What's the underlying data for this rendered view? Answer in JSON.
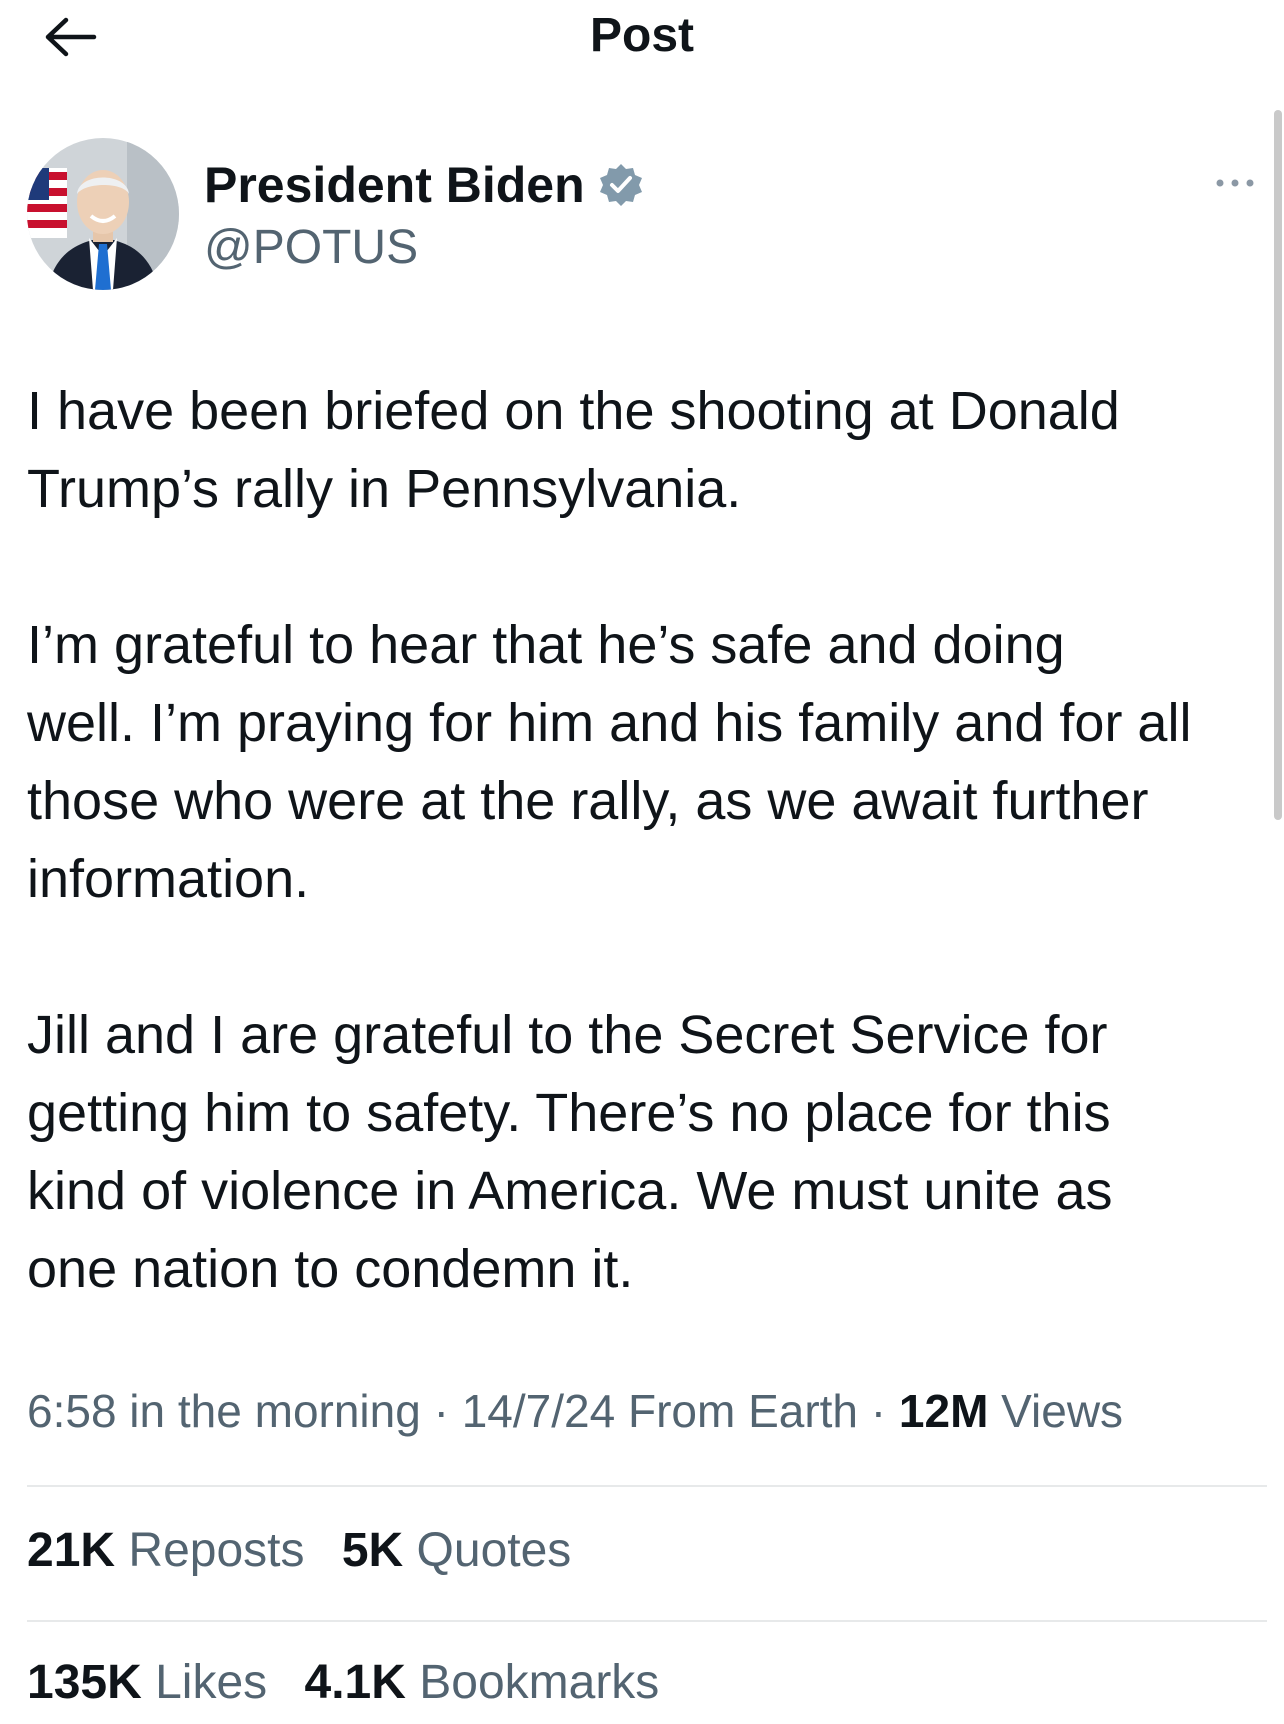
{
  "header": {
    "title": "Post",
    "back_icon": "arrow-left-icon"
  },
  "author": {
    "name": "President Biden",
    "handle": "@POTUS",
    "verified_icon": "verified-badge-icon",
    "verified_color": "#829aab",
    "more_icon": "more-horizontal-icon"
  },
  "post": {
    "paragraphs": [
      [
        "I have been briefed on the shooting at Donald",
        "Trump’s rally in Pennsylvania."
      ],
      [
        "I’m grateful to hear that he’s safe and doing",
        "well. I’m praying for him and his family and for all",
        "those who were at the rally, as we await further",
        "information."
      ],
      [
        "Jill and I are grateful to the Secret Service for",
        "getting him to safety. There’s no place for this",
        "kind of violence in America. We must unite as",
        "one nation to condemn it."
      ]
    ]
  },
  "meta": {
    "time": "6:58 in the morning",
    "sep": "·",
    "date": "14/7/24",
    "source": "From Earth",
    "views_count": "12M",
    "views_label": "Views"
  },
  "stats": {
    "reposts_count": "21K",
    "reposts_label": "Reposts",
    "quotes_count": "5K",
    "quotes_label": "Quotes",
    "likes_count": "135K",
    "likes_label": "Likes",
    "bookmarks_count": "4.1K",
    "bookmarks_label": "Bookmarks"
  },
  "colors": {
    "text_primary": "#0f1419",
    "text_secondary": "#536471",
    "divider": "#e7e9ea"
  }
}
